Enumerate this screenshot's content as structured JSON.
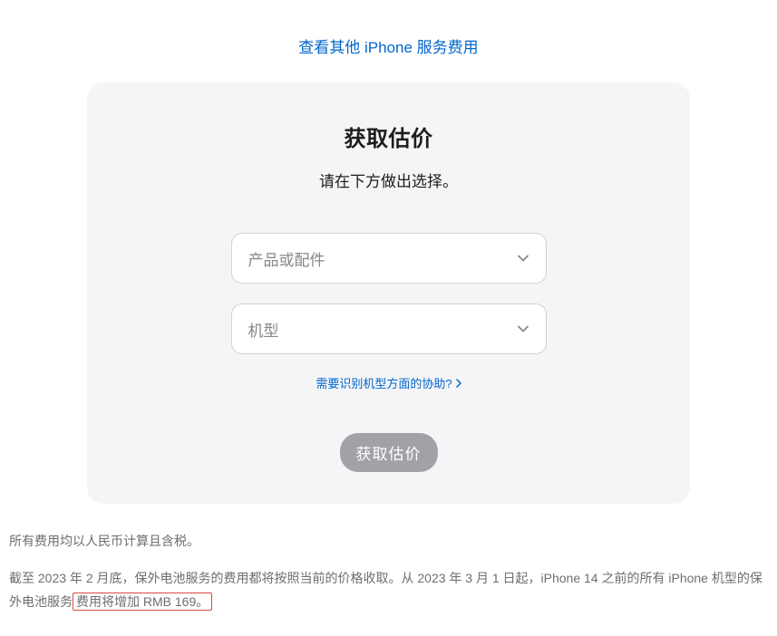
{
  "topLink": "查看其他 iPhone 服务费用",
  "card": {
    "title": "获取估价",
    "subtitle": "请在下方做出选择。",
    "select1": {
      "placeholder": "产品或配件"
    },
    "select2": {
      "placeholder": "机型"
    },
    "helpLink": "需要识别机型方面的协助?",
    "submit": "获取估价"
  },
  "footer": {
    "line1": "所有费用均以人民币计算且含税。",
    "line2_part1": "截至 2023 年 2 月底，保外电池服务的费用都将按照当前的价格收取。从 2023 年 3 月 1 日起，iPhone 14 之前的所有 iPhone 机型的保外电池服务",
    "line2_highlight": "费用将增加 RMB 169。"
  }
}
